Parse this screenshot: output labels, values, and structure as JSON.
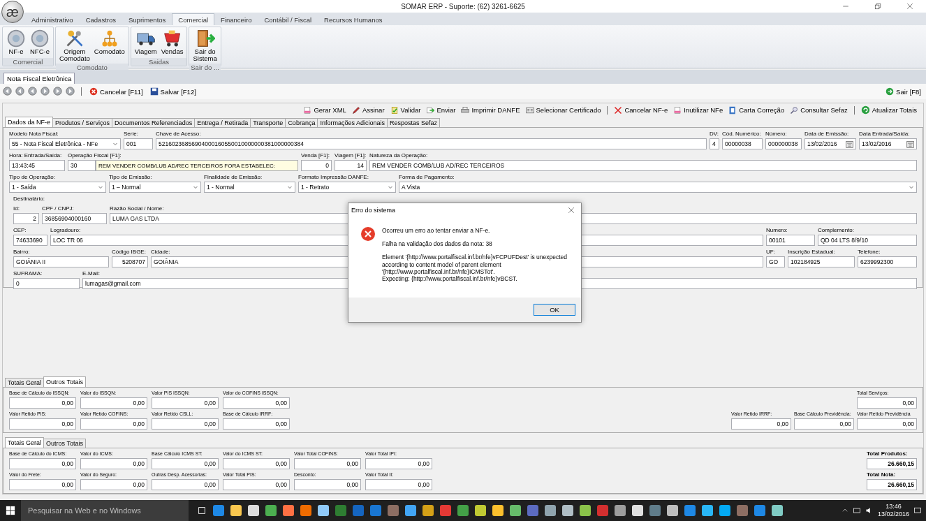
{
  "window": {
    "logo": "æ",
    "title": "SOMAR ERP - Suporte: (62) 3261-6625"
  },
  "ribbon": {
    "tabs": [
      {
        "label": "Administrativo",
        "selected": false
      },
      {
        "label": "Cadastros",
        "selected": false
      },
      {
        "label": "Suprimentos",
        "selected": false
      },
      {
        "label": "Comercial",
        "selected": true
      },
      {
        "label": "Financeiro",
        "selected": false
      },
      {
        "label": "Contábil / Fiscal",
        "selected": false
      },
      {
        "label": "Recursos Humanos",
        "selected": false
      }
    ],
    "groups": [
      {
        "label": "Comercial",
        "buttons": [
          {
            "label": "NF-e",
            "kind": "disc"
          },
          {
            "label": "NFC-e",
            "kind": "disc"
          }
        ]
      },
      {
        "label": "Comodato",
        "buttons": [
          {
            "label": "Origem\nComodato",
            "kind": "tools"
          },
          {
            "label": "Comodato",
            "kind": "hierarchy"
          }
        ]
      },
      {
        "label": "Saidas",
        "buttons": [
          {
            "label": "Viagem",
            "kind": "truck"
          },
          {
            "label": "Vendas",
            "kind": "cart"
          }
        ]
      },
      {
        "label": "Sair do ...",
        "buttons": [
          {
            "label": "Sair do\nSistema",
            "kind": "exit"
          }
        ]
      }
    ]
  },
  "document_tabs": [
    {
      "label": "Nota Fiscal Eletrônica",
      "selected": true
    }
  ],
  "toolbar": {
    "buttons": [
      {
        "label": "Cancelar [F11]",
        "kind": "cancel"
      },
      {
        "label": "Salvar [F12]",
        "kind": "save"
      }
    ],
    "exit": {
      "label": "Sair [F8]"
    }
  },
  "actions": [
    [
      {
        "label": "Gerar XML",
        "kind": "xml"
      },
      {
        "label": "Assinar",
        "kind": "sign"
      },
      {
        "label": "Validar",
        "kind": "validate"
      },
      {
        "label": "Enviar",
        "kind": "send"
      },
      {
        "label": "Imprimir DANFE",
        "kind": "print"
      },
      {
        "label": "Selecionar Certificado",
        "kind": "certificate"
      }
    ],
    [
      {
        "label": "Cancelar NF-e",
        "kind": "cancel"
      },
      {
        "label": "Inutilizar NFe",
        "kind": "xml"
      },
      {
        "label": "Carta Correção",
        "kind": "letter"
      },
      {
        "label": "Consultar Sefaz",
        "kind": "query"
      }
    ],
    [
      {
        "label": "Atualizar Totais",
        "kind": "refresh"
      }
    ]
  ],
  "form_tabs": [
    {
      "label": "Dados da NF-e",
      "selected": true
    },
    {
      "label": "Produtos / Serviços",
      "selected": false
    },
    {
      "label": "Documentos Referenciados",
      "selected": false
    },
    {
      "label": "Entrega / Retirada",
      "selected": false
    },
    {
      "label": "Transporte",
      "selected": false
    },
    {
      "label": "Cobrança",
      "selected": false
    },
    {
      "label": "Informações Adicionais",
      "selected": false
    },
    {
      "label": "Respostas Sefaz",
      "selected": false
    }
  ],
  "form": {
    "rows": [
      [
        {
          "label": "Modelo Nota Fiscal:",
          "value": "55 - Nota Fiscal Eletrônica - NFe",
          "kind": "select"
        },
        {
          "label": "Serie:",
          "value": "001",
          "kind": "text"
        },
        {
          "label": "Chave de Acesso:",
          "value": "52160236856904000160550010000000381000000384",
          "kind": "text"
        },
        {
          "label": "DV:",
          "value": "4",
          "kind": "text"
        },
        {
          "label": "Cód. Numérico:",
          "value": "00000038",
          "kind": "text"
        },
        {
          "label": "Número:",
          "value": "000000038",
          "kind": "text"
        },
        {
          "label": "Data de Emissão:",
          "value": "13/02/2016",
          "kind": "date"
        },
        {
          "label": "Data Entrada/Saída:",
          "value": "13/02/2016",
          "kind": "date"
        }
      ],
      [
        {
          "label": "Hora: Entrada/Saída:",
          "value": "13:43:45",
          "kind": "text"
        },
        {
          "label": "Operação Fiscal [F1]:",
          "value": "30",
          "detail": "REM VENDER COMB/LUB AD/REC TERCEIROS FORA ESTABELEC:",
          "kind": "code"
        },
        {
          "label": "Venda [F1]:",
          "value": "0",
          "kind": "number"
        },
        {
          "label": "Viagem [F1]:",
          "value": "14",
          "kind": "number"
        },
        {
          "label": "Natureza da Operação:",
          "value": "REM VENDER COMB/LUB AD/REC TERCEIROS",
          "kind": "text"
        }
      ],
      [
        {
          "label": "Tipo de Operação:",
          "value": "1 - Saída",
          "kind": "select"
        },
        {
          "label": "Tipo de Emissão:",
          "value": "1 – Normal",
          "kind": "select"
        },
        {
          "label": "Finalidade de Emissão:",
          "value": "1 - Normal",
          "kind": "select"
        },
        {
          "label": "Formato Impressão DANFE:",
          "value": "1 - Retrato",
          "kind": "select"
        },
        {
          "label": "Forma de Pagamento:",
          "value": "A Vista",
          "kind": "select"
        }
      ]
    ],
    "recipient": {
      "label": "Destinatário:",
      "lines": [
        {
          "fields": [
            {
              "label": "Id:",
              "value": "2",
              "kind": "number"
            },
            {
              "label": "CPF / CNPJ:",
              "value": "36856904000160",
              "kind": "text"
            },
            {
              "label": "Razão Social / Nome:",
              "value": "LUMA GAS LTDA",
              "kind": "text"
            }
          ]
        },
        {
          "fields": [
            {
              "label": "CEP:",
              "value": "74633690",
              "kind": "text"
            },
            {
              "label": "Logradouro:",
              "value": "LOC TR 06",
              "kind": "text"
            },
            {
              "label": "Numero:",
              "value": "00101",
              "kind": "text"
            },
            {
              "label": "Complemento:",
              "value": "QD 04 LTS 8/9/10",
              "kind": "text"
            }
          ]
        },
        {
          "fields": [
            {
              "label": "Bairro:",
              "value": "GOIÂNIA II",
              "kind": "text"
            },
            {
              "label": "Código IBGE:",
              "value": "5208707",
              "kind": "number"
            },
            {
              "label": "Cidade:",
              "value": "GOIÂNIA",
              "kind": "text"
            },
            {
              "label": "UF:",
              "value": "GO",
              "kind": "text"
            },
            {
              "label": "Inscrição Estadual:",
              "value": "102184925",
              "kind": "text"
            },
            {
              "label": "Telefone:",
              "value": "6239992300",
              "kind": "text"
            }
          ]
        },
        {
          "fields": [
            {
              "label": "SUFRAMA:",
              "value": "0",
              "kind": "text"
            },
            {
              "label": "E-Mail:",
              "value": "lumagas@gmail.com",
              "kind": "text"
            }
          ]
        }
      ]
    }
  },
  "other_totals": {
    "tabs": [
      {
        "label": "Totais Geral",
        "selected": false
      },
      {
        "label": "Outros Totais",
        "selected": true
      }
    ],
    "rows": [
      {
        "left": [
          {
            "label": "Base de Cálculo do ISSQN:",
            "value": "0,00"
          },
          {
            "label": "Valor do ISSQN:",
            "value": "0,00"
          },
          {
            "label": "Valor PIS ISSQN:",
            "value": "0,00"
          },
          {
            "label": "Valor do COFINS ISSQN:",
            "value": "0,00"
          }
        ],
        "right": [
          {
            "label": "Total Serviços:",
            "value": "0,00"
          }
        ]
      },
      {
        "left": [
          {
            "label": "Valor Retido PIS:",
            "value": "0,00"
          },
          {
            "label": "Valor Retido COFINS:",
            "value": "0,00"
          },
          {
            "label": "Valor Retido CSLL:",
            "value": "0,00"
          },
          {
            "label": "Base de Cálculo IRRF:",
            "value": "0,00"
          }
        ],
        "right": [
          {
            "label": "Valor Retido IRRF:",
            "value": "0,00"
          },
          {
            "label": "Base Cálculo Previdência:",
            "value": "0,00"
          },
          {
            "label": "Valor Retido Previdência",
            "value": "0,00"
          }
        ]
      }
    ]
  },
  "general_totals": {
    "tabs": [
      {
        "label": "Totais Geral",
        "selected": true
      },
      {
        "label": "Outros Totais",
        "selected": false
      }
    ],
    "rows": [
      {
        "left": [
          {
            "label": "Base de Cálculo do ICMS:",
            "value": "0,00"
          },
          {
            "label": "Valor do ICMS:",
            "value": "0,00"
          },
          {
            "label": "Base Cálculo ICMS ST:",
            "value": "0,00"
          },
          {
            "label": "Valor do ICMS ST:",
            "value": "0,00"
          },
          {
            "label": "Valor Total COFINS:",
            "value": "0,00"
          },
          {
            "label": "Valor Total IPI:",
            "value": "0,00"
          }
        ],
        "right": [
          {
            "label": "Total Produtos:",
            "value": "26.660,15",
            "bold": true
          }
        ]
      },
      {
        "left": [
          {
            "label": "Valor do Frete:",
            "value": "0,00"
          },
          {
            "label": "Valor do Seguro:",
            "value": "0,00"
          },
          {
            "label": "Outras Desp. Acessorias:",
            "value": "0,00"
          },
          {
            "label": "Valor Total PIS:",
            "value": "0,00"
          },
          {
            "label": "Desconto:",
            "value": "0,00"
          },
          {
            "label": "Valor Total II:",
            "value": "0,00"
          }
        ],
        "right": [
          {
            "label": "Total Nota:",
            "value": "26.660,15",
            "bold": true
          }
        ]
      }
    ]
  },
  "dialog": {
    "title": "Erro do sistema",
    "messages": [
      "Ocorreu um erro ao tentar enviar a NF-e.",
      "Falha na validação dos dados da nota: 38",
      "Element '{http://www.portalfiscal.inf.br/nfe}vFCPUFDest' is unexpected\naccording to content model of parent element\n'{http://www.portalfiscal.inf.br/nfe}ICMSTot'.\nExpecting: {http://www.portalfiscal.inf.br/nfe}vBCST."
    ],
    "button": "OK"
  },
  "taskbar": {
    "search": {
      "placeholder": "Pesquisar na Web e no Windows"
    },
    "time": "13:46",
    "date": "13/02/2016"
  }
}
